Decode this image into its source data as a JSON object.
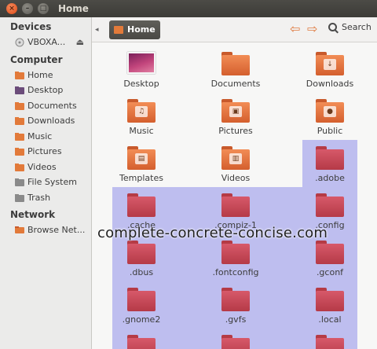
{
  "window": {
    "title": "Home",
    "close": "×",
    "minimize": "–",
    "maximize": "□"
  },
  "sidebar": {
    "sections": [
      {
        "title": "Devices",
        "items": [
          {
            "label": "VBOXA...",
            "icon": "optical-disc-icon"
          }
        ]
      },
      {
        "title": "Computer",
        "items": [
          {
            "label": "Home",
            "icon": "home-folder-icon"
          },
          {
            "label": "Desktop",
            "icon": "desktop-icon"
          },
          {
            "label": "Documents",
            "icon": "documents-folder-icon"
          },
          {
            "label": "Downloads",
            "icon": "downloads-folder-icon"
          },
          {
            "label": "Music",
            "icon": "music-folder-icon"
          },
          {
            "label": "Pictures",
            "icon": "pictures-folder-icon"
          },
          {
            "label": "Videos",
            "icon": "videos-folder-icon"
          },
          {
            "label": "File System",
            "icon": "drive-icon"
          },
          {
            "label": "Trash",
            "icon": "trash-icon"
          }
        ]
      },
      {
        "title": "Network",
        "items": [
          {
            "label": "Browse Net...",
            "icon": "network-icon"
          }
        ]
      }
    ],
    "eject": "⏏"
  },
  "toolbar": {
    "back": "◂",
    "breadcrumb": "Home",
    "nav_back": "⇦",
    "nav_forward": "⇨",
    "search_label": "Search"
  },
  "files": [
    {
      "name": "Desktop",
      "type": "desktop",
      "badge": ""
    },
    {
      "name": "Documents",
      "type": "orange",
      "badge": ""
    },
    {
      "name": "Downloads",
      "type": "orange",
      "badge": "↓"
    },
    {
      "name": "Music",
      "type": "orange",
      "badge": "♫"
    },
    {
      "name": "Pictures",
      "type": "orange",
      "badge": "▣"
    },
    {
      "name": "Public",
      "type": "orange",
      "badge": "●"
    },
    {
      "name": "Templates",
      "type": "orange",
      "badge": "▤"
    },
    {
      "name": "Videos",
      "type": "orange",
      "badge": "▥"
    },
    {
      "name": ".adobe",
      "type": "red",
      "badge": ""
    },
    {
      "name": ".cache",
      "type": "red",
      "badge": ""
    },
    {
      "name": ".compiz-1",
      "type": "red",
      "badge": ""
    },
    {
      "name": ".config",
      "type": "red",
      "badge": ""
    },
    {
      "name": ".dbus",
      "type": "red",
      "badge": ""
    },
    {
      "name": ".fontconfig",
      "type": "red",
      "badge": ""
    },
    {
      "name": ".gconf",
      "type": "red",
      "badge": ""
    },
    {
      "name": ".gnome2",
      "type": "red",
      "badge": ""
    },
    {
      "name": ".gvfs",
      "type": "red",
      "badge": ""
    },
    {
      "name": ".local",
      "type": "red",
      "badge": ""
    },
    {
      "name": "",
      "type": "red",
      "badge": ""
    },
    {
      "name": "",
      "type": "red",
      "badge": ""
    },
    {
      "name": "",
      "type": "red",
      "badge": ""
    }
  ],
  "watermark": "complete-concrete-concise.com",
  "colors": {
    "accent": "#df7a3f",
    "selection": "#a8a8ec",
    "titlebar": "#3c3b37"
  }
}
